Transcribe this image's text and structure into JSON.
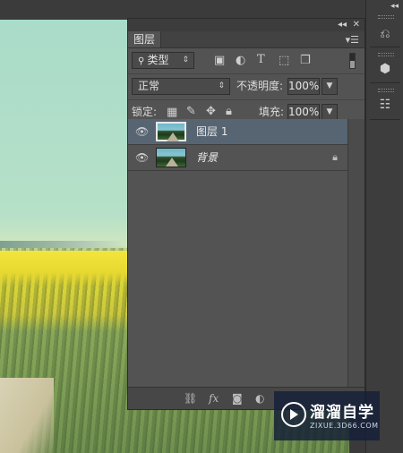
{
  "panel": {
    "tab_label": "图层",
    "filter_kind": "类型",
    "blend_mode": "正常",
    "opacity_label": "不透明度:",
    "opacity_value": "100%",
    "lock_label": "锁定:",
    "fill_label": "填充:",
    "fill_value": "100%",
    "fx_label": "fx"
  },
  "layers": [
    {
      "name": "图层 1",
      "selected": true,
      "locked": false
    },
    {
      "name": "背景",
      "selected": false,
      "locked": true
    }
  ],
  "watermark": {
    "title": "溜溜自学",
    "url": "ZIXUE.3D66.COM"
  }
}
